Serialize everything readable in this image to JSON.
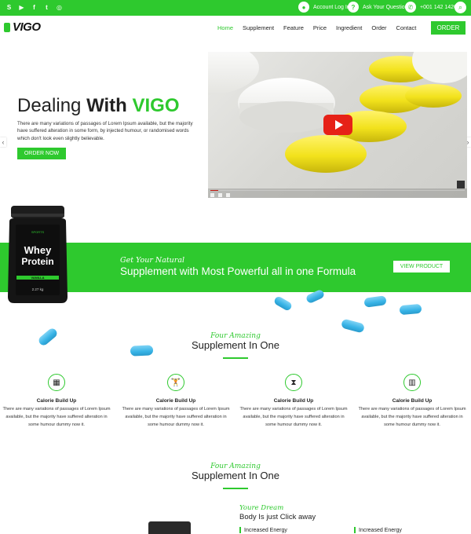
{
  "topbar": {
    "social_icons": [
      "skype-icon",
      "youtube-icon",
      "facebook-icon",
      "twitter-icon",
      "instagram-icon"
    ],
    "account_label": "Account Log In",
    "question_label": "Ask Your Question",
    "phone": "+001 142 1426"
  },
  "header": {
    "logo": "VIGO",
    "nav": [
      "Home",
      "Supplement",
      "Feature",
      "Price",
      "Ingredient",
      "Order",
      "Contact"
    ],
    "active_nav": "Home",
    "order_label": "ORDER"
  },
  "hero": {
    "title_light": "Dealing ",
    "title_bold": "With ",
    "title_green": "VIGO",
    "text": "There are many variations of passages of Lorem Ipsum available, but the majority have suffered alteration in some form, by injected humour, or randomised words which don't look even slightly believable.",
    "button": "ORDER NOW"
  },
  "jar": {
    "label_line1": "Whey",
    "label_line2": "Protein",
    "flavor": "VANILLA",
    "weight": "2.27 kg",
    "brand": "SPORTS"
  },
  "band": {
    "subtitle": "Get Your Natural",
    "title": "Supplement with Most Powerful all in one Formula",
    "button": "VIEW PRODUCT"
  },
  "section1": {
    "subtitle": "Four Amazing",
    "title": "Supplement In One",
    "features": [
      {
        "icon": "tablet-pack-icon",
        "title": "Calorie Build Up",
        "text": "There are many variations of passages of Lorem Ipsum available, but the majority have suffered alteration in some humour dummy now it."
      },
      {
        "icon": "weightlifter-icon",
        "title": "Calorie Build Up",
        "text": "There are many variations of passages of Lorem Ipsum available, but the majority have suffered alteration in some humour dummy now it."
      },
      {
        "icon": "hourglass-icon",
        "title": "Calorie Build Up",
        "text": "There are many variations of passages of Lorem Ipsum available, but the majority have suffered alteration in some humour dummy now it."
      },
      {
        "icon": "bar-chart-icon",
        "title": "Calorie Build Up",
        "text": "There are many variations of passages of Lorem Ipsum available, but the majority have suffered alteration in some humour dummy now it."
      }
    ]
  },
  "section2": {
    "subtitle": "Four Amazing",
    "title": "Supplement In One",
    "dream_sub": "Youre Dream",
    "dream_title": "Body Is just Click away",
    "energy_items": [
      "Increased Energy",
      "Increased Energy"
    ]
  },
  "colors": {
    "accent": "#2ec92e",
    "pill": "#37b3e6",
    "play": "#e62117"
  }
}
